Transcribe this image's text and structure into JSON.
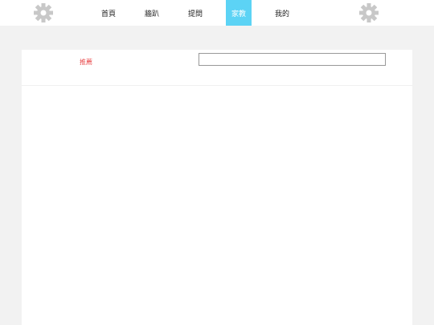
{
  "nav": {
    "items": [
      {
        "label": "首頁"
      },
      {
        "label": "牆趴"
      },
      {
        "label": "提問"
      },
      {
        "label": "家教"
      },
      {
        "label": "我的"
      }
    ],
    "active_index": 3
  },
  "icons": {
    "left": "gear-icon",
    "right": "gear-icon"
  },
  "panel": {
    "recommend_label": "推薦",
    "search": {
      "value": "",
      "placeholder": ""
    }
  },
  "colors": {
    "accent": "#5cd3f5",
    "highlight_text": "#e8484a",
    "icon": "#c8c8c8"
  }
}
